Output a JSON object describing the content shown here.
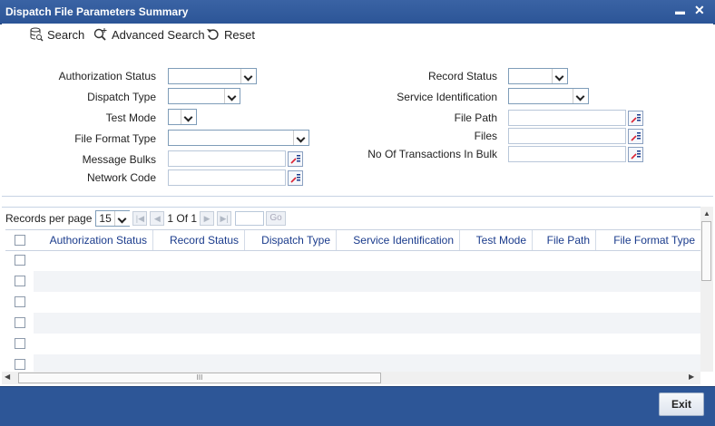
{
  "window": {
    "title": "Dispatch File Parameters Summary",
    "minimize": "▬",
    "close": "✕"
  },
  "toolbar": {
    "search": "Search",
    "advanced_search": "Advanced Search",
    "reset": "Reset"
  },
  "criteria": {
    "authorization_status": "Authorization Status",
    "dispatch_type": "Dispatch Type",
    "test_mode": "Test Mode",
    "file_format_type": "File Format Type",
    "message_bulks": "Message Bulks",
    "network_code": "Network Code",
    "record_status": "Record Status",
    "service_identification": "Service Identification",
    "file_path": "File Path",
    "files": "Files",
    "no_of_transactions_in_bulk": "No Of Transactions In Bulk"
  },
  "pager": {
    "records_per_page_label": "Records per page",
    "records_per_page_value": "15",
    "page_info": "1 Of 1",
    "go_label": "Go"
  },
  "table": {
    "columns": [
      "Authorization Status",
      "Record Status",
      "Dispatch Type",
      "Service Identification",
      "Test Mode",
      "File Path",
      "File Format Type"
    ],
    "rows": [
      {},
      {},
      {},
      {},
      {},
      {}
    ]
  },
  "scroll": {
    "hscroll_thumb_glyph": "III"
  },
  "footer": {
    "exit_label": "Exit"
  }
}
